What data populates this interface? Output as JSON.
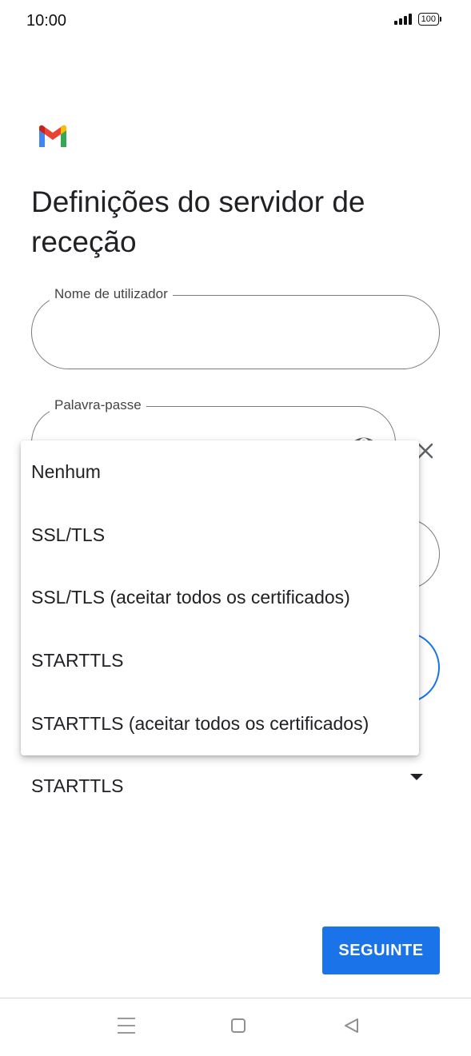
{
  "status_bar": {
    "time": "10:00",
    "battery": "100"
  },
  "title": "Definições do servidor de receção",
  "fields": {
    "username": {
      "label": "Nome de utilizador",
      "value": ""
    },
    "password": {
      "label": "Palavra-passe",
      "value": ""
    }
  },
  "security": {
    "selected": "STARTTLS"
  },
  "dropdown": {
    "options": [
      "Nenhum",
      "SSL/TLS",
      "SSL/TLS (aceitar todos os certificados)",
      "STARTTLS",
      "STARTTLS (aceitar todos os certificados)"
    ]
  },
  "next_button": {
    "label": "SEGUINTE"
  },
  "icons": {
    "logo": "gmail-logo",
    "eye": "eye-icon",
    "close": "close-icon",
    "arrow": "dropdown-arrow-icon",
    "nav": [
      "menu-icon",
      "home-icon",
      "back-icon"
    ]
  },
  "colors": {
    "accent": "#1a73e8"
  }
}
